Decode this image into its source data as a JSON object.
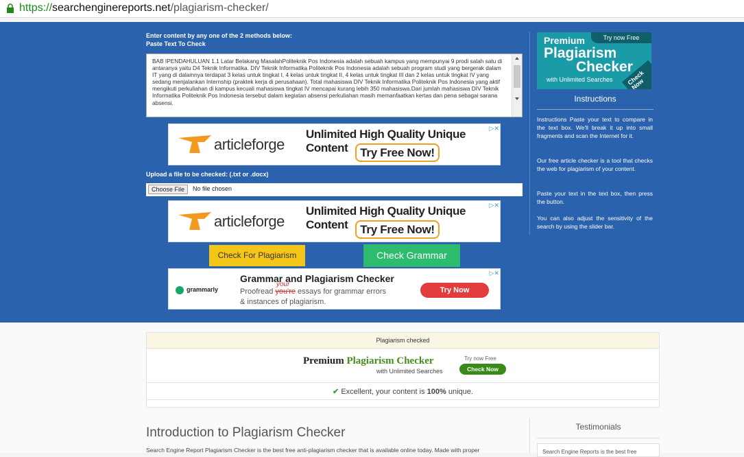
{
  "browser": {
    "url_protocol": "https://",
    "url_host": "searchenginereports.net",
    "url_path": "/plagiarism-checker/"
  },
  "form": {
    "intro_label": "Enter content by any one of the 2 methods below:",
    "paste_label": "Paste Text To Check",
    "textarea_text": "BAB IPENDAHULUAN 1.1   Latar Belakang MasalahPoliteknik Pos Indonesia adalah sebuah kampus yang mempunyai 9 prodi salah satu di antaranya yaitu D4 Teknik Informatika. DIV Teknik Informatika Politeknik Pos Indonesia adalah sebuah program studi yang bergerak dalam IT yang di dalamnya terdapat 3 kelas untuk tingkat I, 4 kelas untuk tingkat II, 4 kelas untuk tingkat III dan 2 kelas untuk tingkat IV yang sedang menjalankan Internship (praktek kerja di perusahaan). Total mahasiswa DIV Teknik Informatika Politeknik Pos Indonesia yang aktif mengikuti perkuliahan di kampus kecuali mahasiswa tingkat IV mencapai kurang lebih 350 mahasiswa.Dari jumlah mahasiswa DIV Teknik Informatika Politeknik Pos Indonesia tersebut dalam kegiatan absensi perkuliahan masih memanfaatkan kertas dan pena sebagai sarana absensi.",
    "upload_label": "Upload a file to be checked: (.txt or .docx)",
    "choose_file": "Choose File",
    "no_file": "No file chosen",
    "check_plagiarism": "Check For Plagiarism",
    "check_grammar": "Check Grammar"
  },
  "ads": {
    "articleforge": {
      "brand": "articleforge",
      "headline": "Unlimited High Quality Unique Content",
      "cta": "Try Free Now!"
    },
    "grammarly": {
      "brand": "grammarly",
      "headline": "Grammar and Plagiarism Checker",
      "line1_pre": "Proofread ",
      "line1_strike": "you're",
      "line1_post": " essays for grammar errors",
      "line1_correction": "your",
      "line2": "& instances of plagiarism.",
      "cta": "Try Now"
    }
  },
  "sidebar": {
    "premium": {
      "try_now": "Try now Free",
      "word1": "Premium",
      "word2": "Plagiarism",
      "word3": "Checker",
      "sub": "with Unlimited Searches",
      "check_now": "Check Now"
    },
    "instructions_title": "Instructions",
    "instructions": [
      "Instructions Paste your text to compare in the text box. We'll break it up into small fragments and scan the Internet for it.",
      "Our free article checker is a tool that checks the web for plagiarism of your content.",
      "Paste your text in the text box, then press the button.",
      "You can also adjust the sensitivity of the search by using the slider bar."
    ]
  },
  "results": {
    "header": "Plagiarism checked",
    "banner_premium": "Premium",
    "banner_plag": "Plagiarism Checker",
    "banner_sub": "with Unlimited Searches",
    "banner_try": "Try now Free",
    "banner_btn": "Check Now",
    "result_pre": "Excellent, your content is ",
    "result_pct": "100%",
    "result_post": " unique."
  },
  "lower": {
    "intro_title": "Introduction to Plagiarism Checker",
    "intro_text": "Search Engine Report Plagiarism Checker is the best free anti-plagiarism checker that is available online today. Made with proper",
    "testimonials_title": "Testimonials",
    "testimonial_snippet": "Search Engine Reports is the best free"
  },
  "colors": {
    "page_blue": "#2b62ad",
    "check_yellow": "#f5c518",
    "grammar_green": "#2dbb6e",
    "premium_teal": "#1b9ba8"
  }
}
